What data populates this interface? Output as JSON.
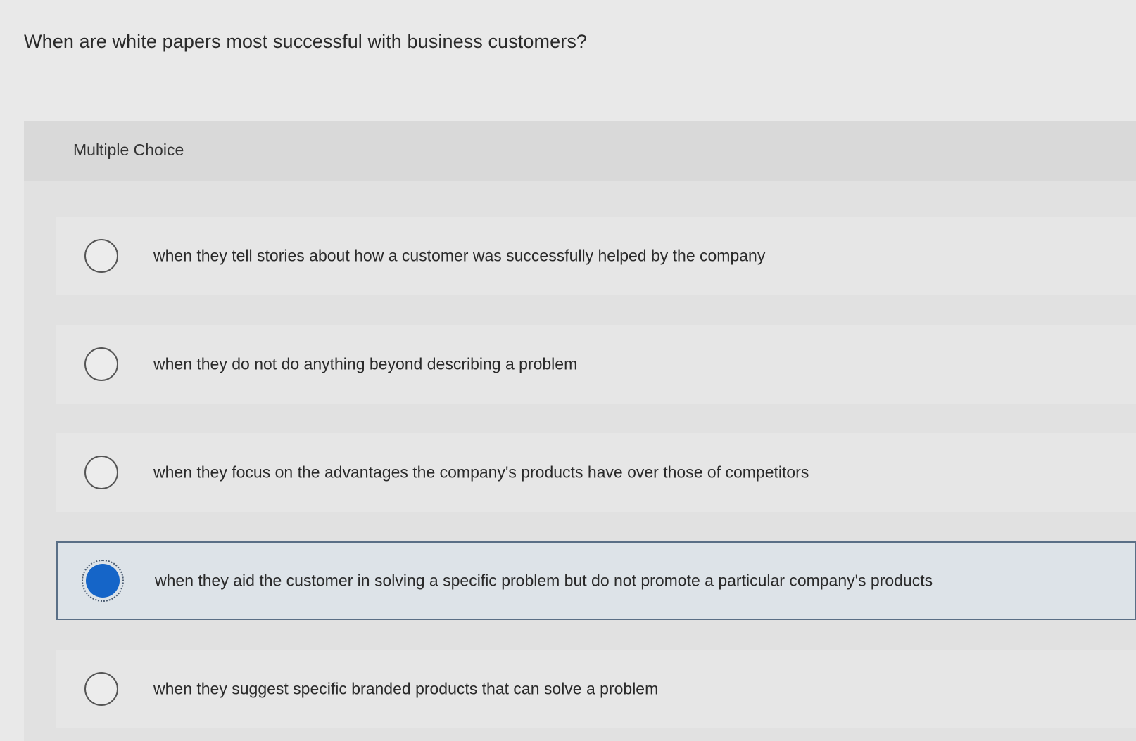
{
  "question": {
    "text": "When are white papers most successful with business customers?"
  },
  "multiple_choice": {
    "label": "Multiple Choice",
    "selected_index": 3,
    "options": [
      {
        "label": "when they tell stories about how a customer was successfully helped by the company",
        "selected": false
      },
      {
        "label": "when they do not do anything beyond describing a problem",
        "selected": false
      },
      {
        "label": "when they focus on the advantages the company's products have over those of competitors",
        "selected": false
      },
      {
        "label": "when they aid the customer in solving a specific problem but do not promote a particular company's products",
        "selected": true
      },
      {
        "label": "when they suggest specific branded products that can solve a problem",
        "selected": false
      }
    ]
  },
  "colors": {
    "selected_radio": "#1565c8",
    "selected_border": "#5a6f86"
  }
}
